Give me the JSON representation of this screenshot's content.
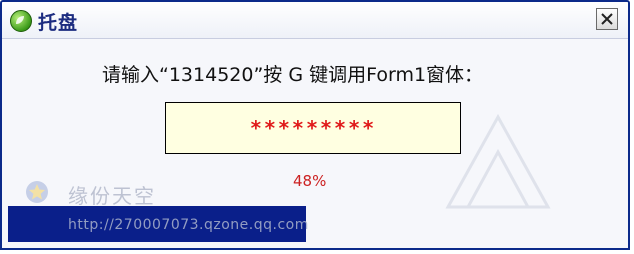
{
  "window": {
    "title": "托盘",
    "app_icon": "leaf-icon",
    "close_icon": "close-icon"
  },
  "prompt": {
    "text": "请输入“1314520”按 G 键调用Form1窗体："
  },
  "password": {
    "value": "*********"
  },
  "progress": {
    "percent_label": "48%",
    "fraction": 0.48
  },
  "watermark": {
    "name": "缘份天空",
    "url": "http://270007073.qzone.qq.com"
  },
  "colors": {
    "title_text": "#1c2c80",
    "password_fill": "#ffffe1",
    "password_text": "#e01a1a",
    "percent_text": "#cc2222",
    "status_bar": "#0a1f8a"
  }
}
